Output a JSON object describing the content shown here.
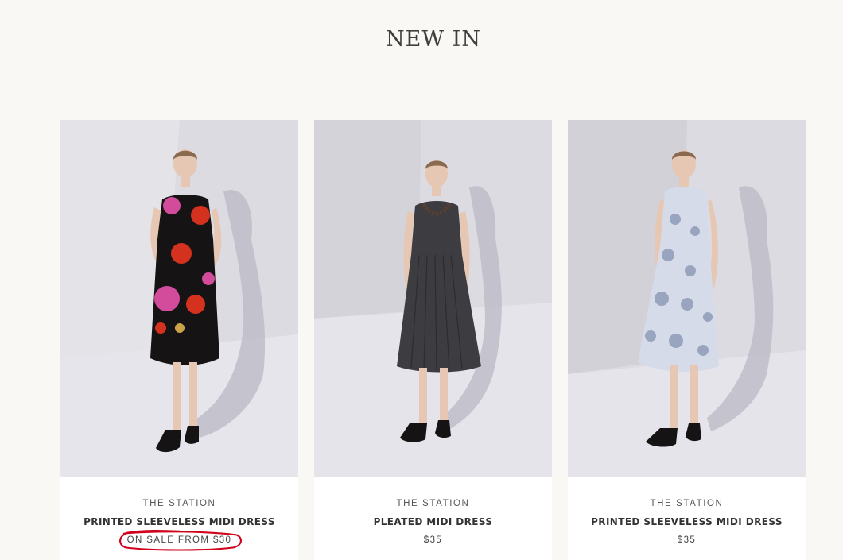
{
  "section": {
    "title": "NEW IN"
  },
  "products": [
    {
      "brand": "THE STATION",
      "name": "PRINTED SLEEVELESS MIDI DRESS",
      "price": "ON SALE FROM $30",
      "image_alt": "Model wearing black sleeveless midi dress with large pink and red poppy print",
      "annotation_color": "#d0021b"
    },
    {
      "brand": "THE STATION",
      "name": "PLEATED MIDI DRESS",
      "price": "$35",
      "image_alt": "Model wearing charcoal grey pleated sleeveless midi dress with beaded necklace"
    },
    {
      "brand": "THE STATION",
      "name": "PRINTED SLEEVELESS MIDI DRESS",
      "price": "$35",
      "image_alt": "Model wearing pale blue floral print sleeveless midi dress with keyhole neckline"
    }
  ],
  "colors": {
    "page_background": "#f9f8f5",
    "card_background": "#ffffff",
    "photo_backdrop": "#d9d8e0",
    "annotation_red": "#d0021b"
  }
}
